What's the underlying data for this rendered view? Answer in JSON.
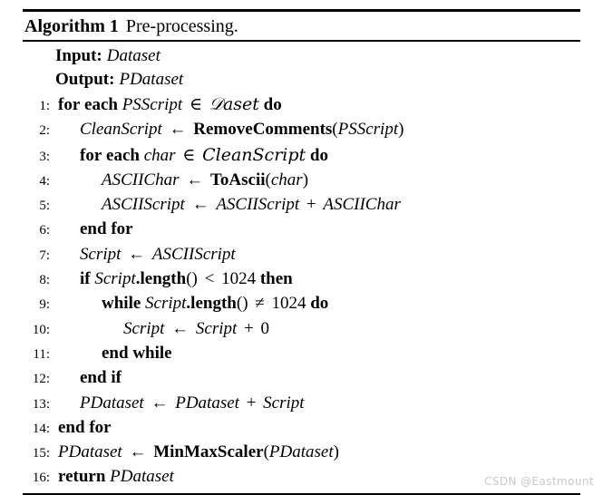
{
  "algorithm": {
    "title_label": "Algorithm 1",
    "title_caption": "Pre-processing.",
    "io": [
      {
        "key": "Input:",
        "value": "Dataset"
      },
      {
        "key": "Output:",
        "value": "PDataset"
      }
    ],
    "lines": [
      {
        "num": "1:",
        "indent": 0,
        "text": "for each PSScript ∈ 𝒟aset do"
      },
      {
        "num": "2:",
        "indent": 1,
        "text": "CleanScript ← RemoveComments(PSScript)"
      },
      {
        "num": "3:",
        "indent": 1,
        "text": "for each char ∈ CleanScript do"
      },
      {
        "num": "4:",
        "indent": 2,
        "text": "ASCIIChar ← ToAscii(char)"
      },
      {
        "num": "5:",
        "indent": 2,
        "text": "ASCIIScript ← ASCIIScript + ASCIIChar"
      },
      {
        "num": "6:",
        "indent": 1,
        "text": "end for"
      },
      {
        "num": "7:",
        "indent": 1,
        "text": "Script ← ASCIIScript"
      },
      {
        "num": "8:",
        "indent": 1,
        "text": "if Script.length() < 1024 then"
      },
      {
        "num": "9:",
        "indent": 2,
        "text": "while Script.length() ≠ 1024 do"
      },
      {
        "num": "10:",
        "indent": 3,
        "text": "Script ← Script + 0"
      },
      {
        "num": "11:",
        "indent": 2,
        "text": "end while"
      },
      {
        "num": "12:",
        "indent": 1,
        "text": "end if"
      },
      {
        "num": "13:",
        "indent": 1,
        "text": "PDataset ← PDataset + Script"
      },
      {
        "num": "14:",
        "indent": 0,
        "text": "end for"
      },
      {
        "num": "15:",
        "indent": 0,
        "text": "PDataset ← MinMaxScaler(PDataset)"
      },
      {
        "num": "16:",
        "indent": 0,
        "text": "return PDataset"
      }
    ]
  },
  "watermark": {
    "text": "CSDN @Eastmount",
    "color": "#c9c9c9"
  }
}
